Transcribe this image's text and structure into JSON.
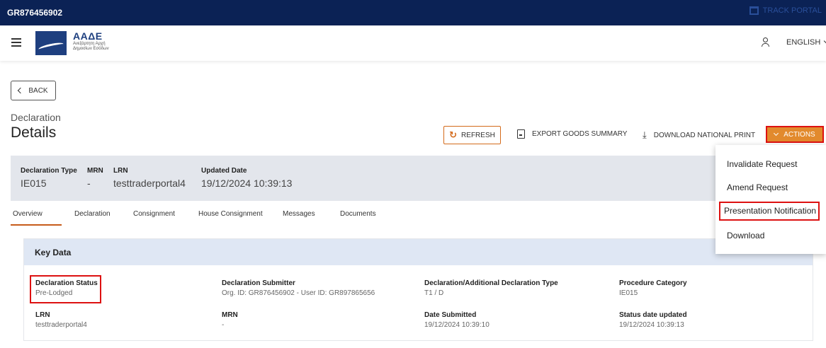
{
  "topbar": {
    "eori": "GR876456902",
    "track_label": "TRACK PORTAL"
  },
  "header": {
    "logo_title": "ΑΑΔΕ",
    "logo_sub1": "Ανεξάρτητη Αρχή",
    "logo_sub2": "Δημοσίων Εσόδων",
    "language": "ENGLISH"
  },
  "nav": {
    "back_label": "BACK"
  },
  "page": {
    "subtitle": "Declaration",
    "title": "Details"
  },
  "toolbar": {
    "refresh_label": "REFRESH",
    "export_label": "EXPORT GOODS SUMMARY",
    "download_label": "DOWNLOAD NATIONAL PRINT",
    "actions_label": "ACTIONS"
  },
  "summary": {
    "declaration_type_label": "Declaration Type",
    "declaration_type_value": "IE015",
    "mrn_label": "MRN",
    "mrn_value": "-",
    "lrn_label": "LRN",
    "lrn_value": "testtraderportal4",
    "updated_label": "Updated Date",
    "updated_value": "19/12/2024 10:39:13"
  },
  "tabs": [
    "Overview",
    "Declaration",
    "Consignment",
    "House Consignment",
    "Messages",
    "Documents"
  ],
  "key_data": {
    "title": "Key Data",
    "fields": [
      {
        "label": "Declaration Status",
        "value": "Pre-Lodged"
      },
      {
        "label": "Declaration Submitter",
        "value": "Org. ID: GR876456902 - User ID: GR897865656"
      },
      {
        "label": "Declaration/Additional Declaration Type",
        "value": "T1 / D"
      },
      {
        "label": "Procedure Category",
        "value": "IE015"
      },
      {
        "label": "LRN",
        "value": "testtraderportal4"
      },
      {
        "label": "MRN",
        "value": "-"
      },
      {
        "label": "Date Submitted",
        "value": "19/12/2024 10:39:10"
      },
      {
        "label": "Status date updated",
        "value": "19/12/2024 10:39:13"
      }
    ]
  },
  "actions_menu": [
    "Invalidate Request",
    "Amend Request",
    "Presentation Notification",
    "Download"
  ],
  "colors": {
    "navy": "#0b2255",
    "accent": "#e28a2d",
    "highlight": "#dd1111"
  }
}
